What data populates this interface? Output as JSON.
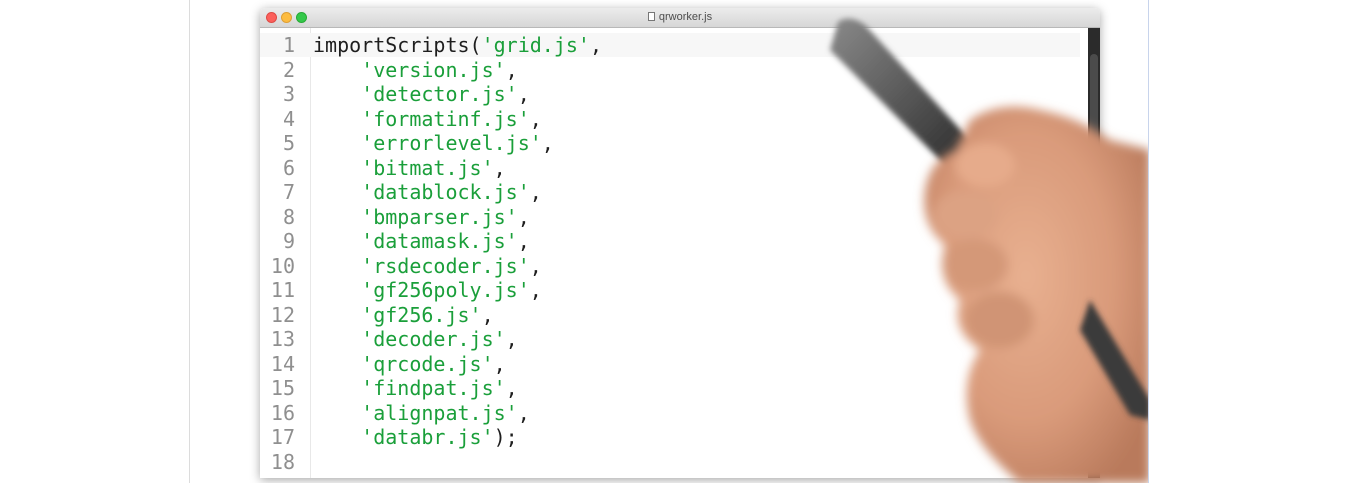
{
  "window": {
    "title": "qrworker.js"
  },
  "editor": {
    "lines": [
      {
        "num": "1",
        "indent": "",
        "pre": "importScripts(",
        "str": "'grid.js'",
        "post": ","
      },
      {
        "num": "2",
        "indent": "    ",
        "pre": "",
        "str": "'version.js'",
        "post": ","
      },
      {
        "num": "3",
        "indent": "    ",
        "pre": "",
        "str": "'detector.js'",
        "post": ","
      },
      {
        "num": "4",
        "indent": "    ",
        "pre": "",
        "str": "'formatinf.js'",
        "post": ","
      },
      {
        "num": "5",
        "indent": "    ",
        "pre": "",
        "str": "'errorlevel.js'",
        "post": ","
      },
      {
        "num": "6",
        "indent": "    ",
        "pre": "",
        "str": "'bitmat.js'",
        "post": ","
      },
      {
        "num": "7",
        "indent": "    ",
        "pre": "",
        "str": "'datablock.js'",
        "post": ","
      },
      {
        "num": "8",
        "indent": "    ",
        "pre": "",
        "str": "'bmparser.js'",
        "post": ","
      },
      {
        "num": "9",
        "indent": "    ",
        "pre": "",
        "str": "'datamask.js'",
        "post": ","
      },
      {
        "num": "10",
        "indent": "    ",
        "pre": "",
        "str": "'rsdecoder.js'",
        "post": ","
      },
      {
        "num": "11",
        "indent": "    ",
        "pre": "",
        "str": "'gf256poly.js'",
        "post": ","
      },
      {
        "num": "12",
        "indent": "    ",
        "pre": "",
        "str": "'gf256.js'",
        "post": ","
      },
      {
        "num": "13",
        "indent": "    ",
        "pre": "",
        "str": "'decoder.js'",
        "post": ","
      },
      {
        "num": "14",
        "indent": "    ",
        "pre": "",
        "str": "'qrcode.js'",
        "post": ","
      },
      {
        "num": "15",
        "indent": "    ",
        "pre": "",
        "str": "'findpat.js'",
        "post": ","
      },
      {
        "num": "16",
        "indent": "    ",
        "pre": "",
        "str": "'alignpat.js'",
        "post": ","
      },
      {
        "num": "17",
        "indent": "    ",
        "pre": "",
        "str": "'databr.js'",
        "post": ");"
      },
      {
        "num": "18",
        "indent": "",
        "pre": "",
        "str": "",
        "post": ""
      }
    ]
  },
  "colors": {
    "string": "#1a9f3a",
    "plain": "#1e1e1e",
    "line_number": "#8f8f8f"
  },
  "icons": {
    "traffic_lights": [
      "close-icon",
      "minimize-icon",
      "maximize-icon"
    ],
    "document": "document-icon"
  }
}
